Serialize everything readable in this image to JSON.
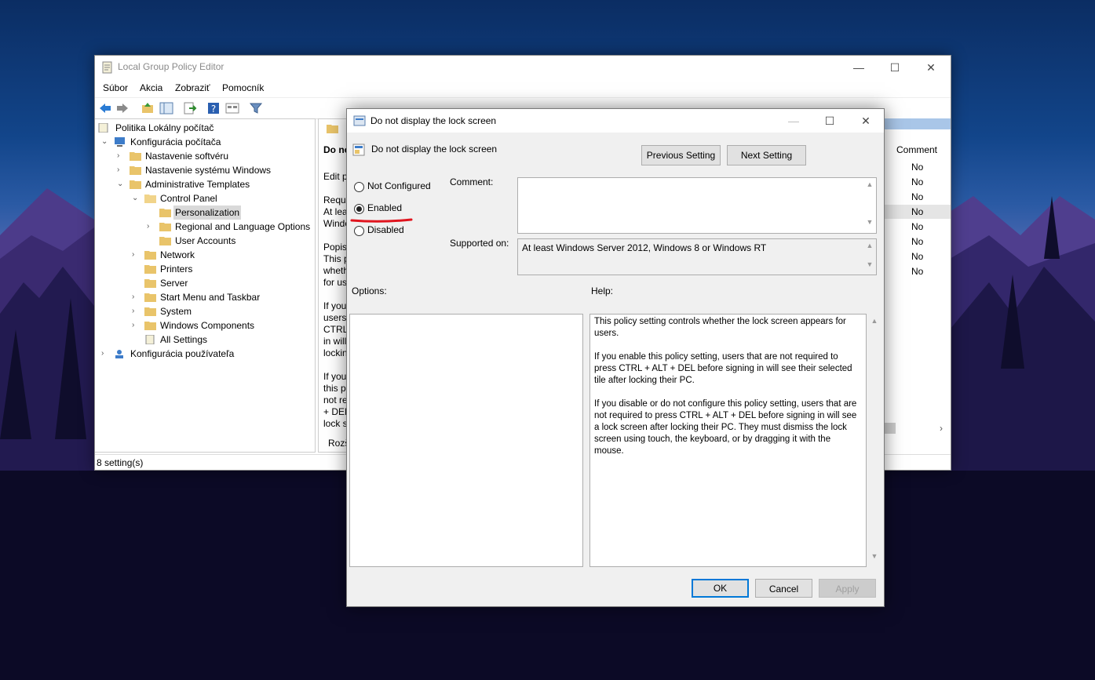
{
  "main_window": {
    "title": "Local Group Policy Editor",
    "controls": {
      "minimize": "—",
      "maximize": "☐",
      "close": "✕"
    },
    "menu": [
      "Súbor",
      "Akcia",
      "Zobraziť",
      "Pomocník"
    ],
    "tree": {
      "root": "Politika Lokálny počítač",
      "computer_config": "Konfigurácia počítača",
      "software_settings": "Nastavenie softvéru",
      "windows_settings": "Nastavenie systému Windows",
      "admin_templates": "Administrative Templates",
      "control_panel": "Control Panel",
      "personalization": "Personalization",
      "regional": "Regional and Language Options",
      "user_accounts": "User Accounts",
      "network": "Network",
      "printers": "Printers",
      "server": "Server",
      "start_menu": "Start Menu and Taskbar",
      "system": "System",
      "windows_components": "Windows Components",
      "all_settings": "All Settings",
      "user_config": "Konfigurácia používateľa"
    },
    "middle_fragments": [
      "Do no",
      "Edit p",
      "Requi",
      "At lea",
      "Windo",
      "Popis:",
      "This p",
      "wheth",
      "for us",
      "If you",
      "users",
      "CTRL",
      "in will",
      "lockin",
      "If you",
      "this p",
      "not re",
      "+ DEL",
      "lock s",
      "Rozš"
    ],
    "comment_column": {
      "header": "Comment",
      "values": [
        "No",
        "No",
        "No",
        "No",
        "No",
        "No",
        "No",
        "No"
      ]
    },
    "status": "8 setting(s)"
  },
  "dialog": {
    "title": "Do not display the lock screen",
    "setting_name": "Do not display the lock screen",
    "previous_button": "Previous Setting",
    "next_button": "Next Setting",
    "state_options": [
      {
        "label": "Not Configured",
        "selected": false
      },
      {
        "label": "Enabled",
        "selected": true
      },
      {
        "label": "Disabled",
        "selected": false
      }
    ],
    "comment_label": "Comment:",
    "comment_value": "",
    "supported_label": "Supported on:",
    "supported_value": "At least Windows Server 2012, Windows 8 or Windows RT",
    "options_label": "Options:",
    "help_label": "Help:",
    "help_paragraphs": [
      "This policy setting controls whether the lock screen appears for users.",
      "If you enable this policy setting, users that are not required to press CTRL + ALT + DEL before signing in will see their selected tile after locking their PC.",
      "If you disable or do not configure this policy setting, users that are not required to press CTRL + ALT + DEL before signing in will see a lock screen after locking their PC. They must dismiss the lock screen using touch, the keyboard, or by dragging it with the mouse."
    ],
    "ok_button": "OK",
    "cancel_button": "Cancel",
    "apply_button": "Apply",
    "annotation_color": "#e0141e"
  }
}
